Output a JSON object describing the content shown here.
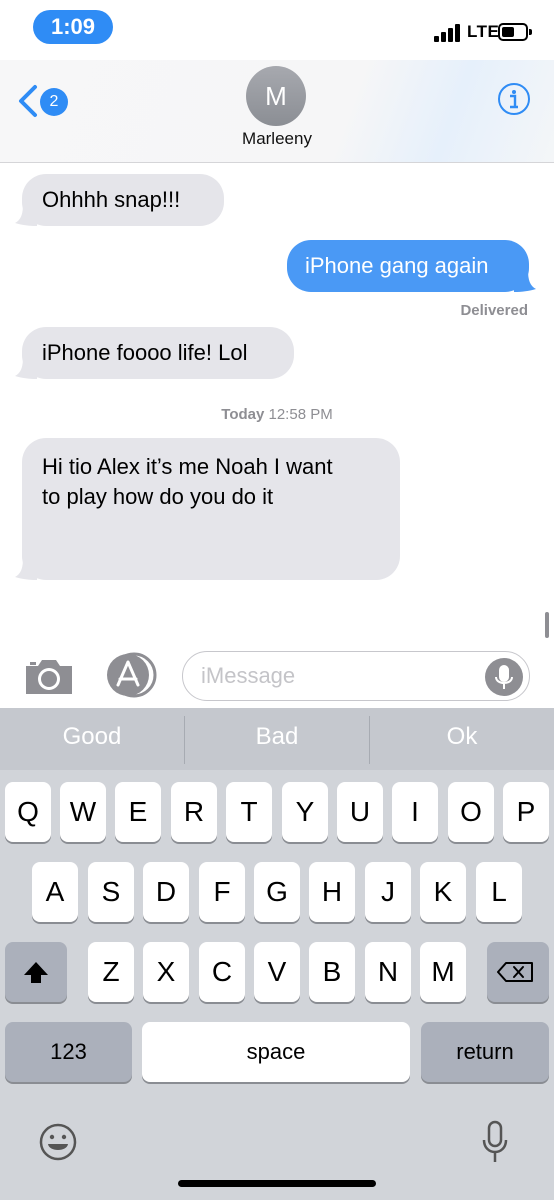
{
  "status_bar": {
    "time": "1:09",
    "network": "LTE"
  },
  "header": {
    "back_badge": "2",
    "avatar_initial": "M",
    "contact_name": "Marleeny"
  },
  "conversation": {
    "messages": [
      {
        "direction": "in",
        "text": "Ohhhh snap!!!"
      },
      {
        "direction": "out",
        "text": "iPhone gang again"
      },
      {
        "direction": "in",
        "text": "iPhone foooo life! Lol"
      },
      {
        "direction": "in",
        "lines": [
          "Hi tio Alex it’s me Noah I want",
          "to play how do you do it"
        ]
      }
    ],
    "delivered_label": "Delivered",
    "timestamp_day": "Today",
    "timestamp_time": "12:58 PM"
  },
  "input": {
    "placeholder": "iMessage",
    "value": ""
  },
  "keyboard": {
    "predictions": [
      "Good",
      "Bad",
      "Ok"
    ],
    "row1": [
      "Q",
      "W",
      "E",
      "R",
      "T",
      "Y",
      "U",
      "I",
      "O",
      "P"
    ],
    "row2": [
      "A",
      "S",
      "D",
      "F",
      "G",
      "H",
      "J",
      "K",
      "L"
    ],
    "row3": [
      "Z",
      "X",
      "C",
      "V",
      "B",
      "N",
      "M"
    ],
    "numbers_label": "123",
    "space_label": "space",
    "return_label": "return"
  },
  "colors": {
    "accent": "#2f8cf5",
    "outgoing_bubble": "#4a99f5",
    "incoming_bubble": "#e5e5ea",
    "keyboard_bg": "#d1d4d9"
  }
}
